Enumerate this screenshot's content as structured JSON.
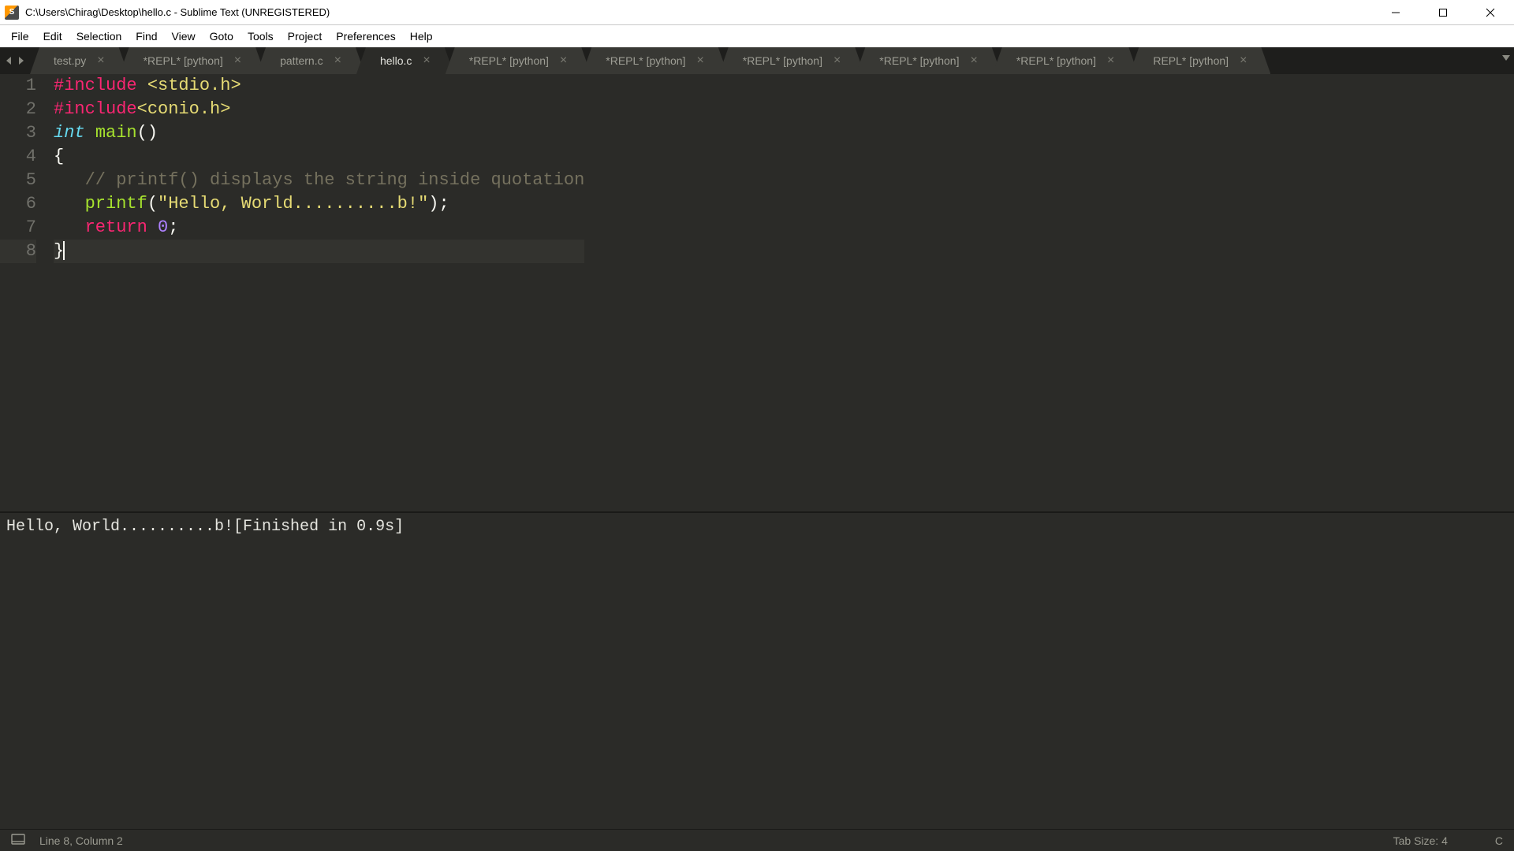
{
  "window": {
    "title": "C:\\Users\\Chirag\\Desktop\\hello.c - Sublime Text (UNREGISTERED)"
  },
  "menu": {
    "items": [
      "File",
      "Edit",
      "Selection",
      "Find",
      "View",
      "Goto",
      "Tools",
      "Project",
      "Preferences",
      "Help"
    ]
  },
  "tabs": [
    {
      "label": "test.py",
      "active": false
    },
    {
      "label": "*REPL* [python]",
      "active": false
    },
    {
      "label": "pattern.c",
      "active": false
    },
    {
      "label": "hello.c",
      "active": true
    },
    {
      "label": "*REPL* [python]",
      "active": false
    },
    {
      "label": "*REPL* [python]",
      "active": false
    },
    {
      "label": "*REPL* [python]",
      "active": false
    },
    {
      "label": "*REPL* [python]",
      "active": false
    },
    {
      "label": "*REPL* [python]",
      "active": false
    },
    {
      "label": "REPL* [python]",
      "active": false
    }
  ],
  "code": {
    "lines": [
      {
        "n": 1,
        "tokens": [
          {
            "t": "#include",
            "c": "kw-red"
          },
          {
            "t": " ",
            "c": ""
          },
          {
            "t": "<stdio.h>",
            "c": "kw-yellow"
          }
        ]
      },
      {
        "n": 2,
        "tokens": [
          {
            "t": "#include",
            "c": "kw-red"
          },
          {
            "t": "<conio.h>",
            "c": "kw-yellow"
          }
        ]
      },
      {
        "n": 3,
        "tokens": [
          {
            "t": "int",
            "c": "kw-type"
          },
          {
            "t": " ",
            "c": ""
          },
          {
            "t": "main",
            "c": "kw-func"
          },
          {
            "t": "()",
            "c": "kw-punct"
          }
        ]
      },
      {
        "n": 4,
        "tokens": [
          {
            "t": "{",
            "c": "kw-punct"
          }
        ]
      },
      {
        "n": 5,
        "tokens": [
          {
            "t": "   ",
            "c": ""
          },
          {
            "t": "// printf() displays the string inside quotation",
            "c": "kw-comment"
          }
        ]
      },
      {
        "n": 6,
        "tokens": [
          {
            "t": "   ",
            "c": ""
          },
          {
            "t": "printf",
            "c": "kw-func"
          },
          {
            "t": "(",
            "c": "kw-punct"
          },
          {
            "t": "\"Hello, World..........b!\"",
            "c": "kw-yellow"
          },
          {
            "t": ");",
            "c": "kw-punct"
          }
        ]
      },
      {
        "n": 7,
        "tokens": [
          {
            "t": "   ",
            "c": ""
          },
          {
            "t": "return",
            "c": "kw-red"
          },
          {
            "t": " ",
            "c": ""
          },
          {
            "t": "0",
            "c": "kw-num"
          },
          {
            "t": ";",
            "c": "kw-punct"
          }
        ]
      },
      {
        "n": 8,
        "active": true,
        "tokens": [
          {
            "t": "}",
            "c": "kw-punct"
          }
        ]
      }
    ]
  },
  "output": {
    "text": "Hello, World..........b![Finished in 0.9s]"
  },
  "status": {
    "position": "Line 8, Column 2",
    "tab_size": "Tab Size: 4",
    "syntax": "C"
  }
}
